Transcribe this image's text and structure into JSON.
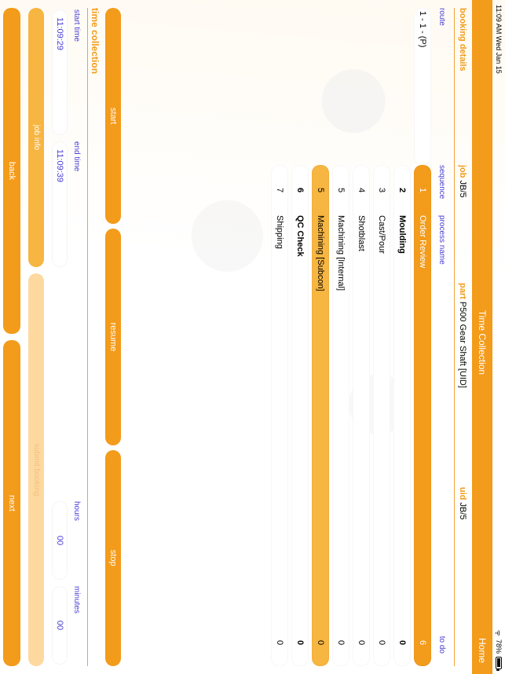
{
  "status": {
    "left": "11:09 AM  Wed Jan 15",
    "battery_pct": "78%"
  },
  "titlebar": {
    "title": "Time Collection",
    "home": "Home"
  },
  "booking": {
    "section": "booking details",
    "job_label": "job",
    "job_val": "JB/5",
    "part_label": "part",
    "part_val": "P500 Gear Shaft [UID]",
    "uid_label": "uid",
    "uid_val": "JB/5",
    "sub": {
      "route": "route",
      "sequence": "sequence",
      "process": "process name",
      "todo": "to do"
    },
    "route_val": "1 - 1 -   (P)",
    "rows": [
      {
        "seq": "1",
        "name": "Order Review",
        "todo": "6",
        "sel": true
      },
      {
        "seq": "2",
        "name": "Moulding",
        "todo": "0",
        "bold": true
      },
      {
        "seq": "3",
        "name": "Cast/Pour",
        "todo": "0"
      },
      {
        "seq": "4",
        "name": "Shotblast",
        "todo": "0"
      },
      {
        "seq": "5",
        "name": "Machining [Internal]",
        "todo": "0"
      },
      {
        "seq": "5",
        "name": "Machining [Subcon]",
        "todo": "0",
        "hl": true
      },
      {
        "seq": "6",
        "name": "QC Check",
        "todo": "0",
        "bold": true
      },
      {
        "seq": "7",
        "name": "Shipping",
        "todo": "0"
      }
    ]
  },
  "actions": {
    "start": "start",
    "resume": "resume",
    "stop": "stop"
  },
  "timec": {
    "section": "time collection",
    "labels": {
      "start": "start time",
      "end": "end time",
      "hours": "hours",
      "minutes": "minutes"
    },
    "values": {
      "start": "11:09:29",
      "end": "11:09:39",
      "hours": "00",
      "minutes": "00"
    },
    "jobinfo": "job info",
    "submit": "submit booking"
  },
  "footer": {
    "back": "back",
    "next": "next"
  }
}
